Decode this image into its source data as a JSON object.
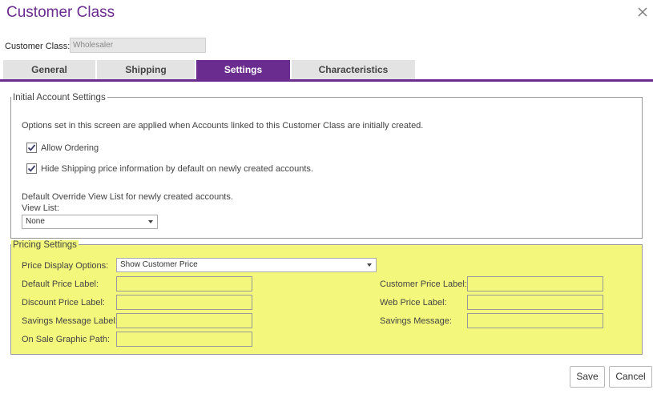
{
  "dialog": {
    "title": "Customer Class",
    "close_icon": "close-icon"
  },
  "customer_class": {
    "label": "Customer Class:",
    "value": "Wholesaler"
  },
  "tabs": [
    {
      "label": "General",
      "active": false
    },
    {
      "label": "Shipping",
      "active": false
    },
    {
      "label": "Settings",
      "active": true
    },
    {
      "label": "Characteristics",
      "active": false
    }
  ],
  "initial_account_settings": {
    "legend": "Initial Account Settings",
    "description": "Options set in this screen are applied when Accounts linked to this Customer Class are initially created.",
    "allow_ordering": {
      "label": "Allow Ordering",
      "checked": true
    },
    "hide_shipping": {
      "label": "Hide Shipping price information by default on newly created accounts.",
      "checked": true
    },
    "override_text": "Default Override View List for newly created accounts.",
    "view_list": {
      "label": "View List:",
      "value": "None"
    }
  },
  "pricing_settings": {
    "legend": "Pricing Settings",
    "price_display": {
      "label": "Price Display Options:",
      "value": "Show Customer Price"
    },
    "default_price_label": {
      "label": "Default Price Label:",
      "value": ""
    },
    "discount_price_label": {
      "label": "Discount Price Label:",
      "value": ""
    },
    "savings_message_label": {
      "label": "Savings Message Label:",
      "value": ""
    },
    "on_sale_graphic_path": {
      "label": "On Sale Graphic Path:",
      "value": ""
    },
    "customer_price_label": {
      "label": "Customer Price Label:",
      "value": ""
    },
    "web_price_label": {
      "label": "Web Price Label:",
      "value": ""
    },
    "savings_message": {
      "label": "Savings Message:",
      "value": ""
    },
    "highlight_color": "#f3f77b"
  },
  "footer": {
    "save_label": "Save",
    "cancel_label": "Cancel"
  },
  "colors": {
    "accent": "#6a2c8e"
  }
}
